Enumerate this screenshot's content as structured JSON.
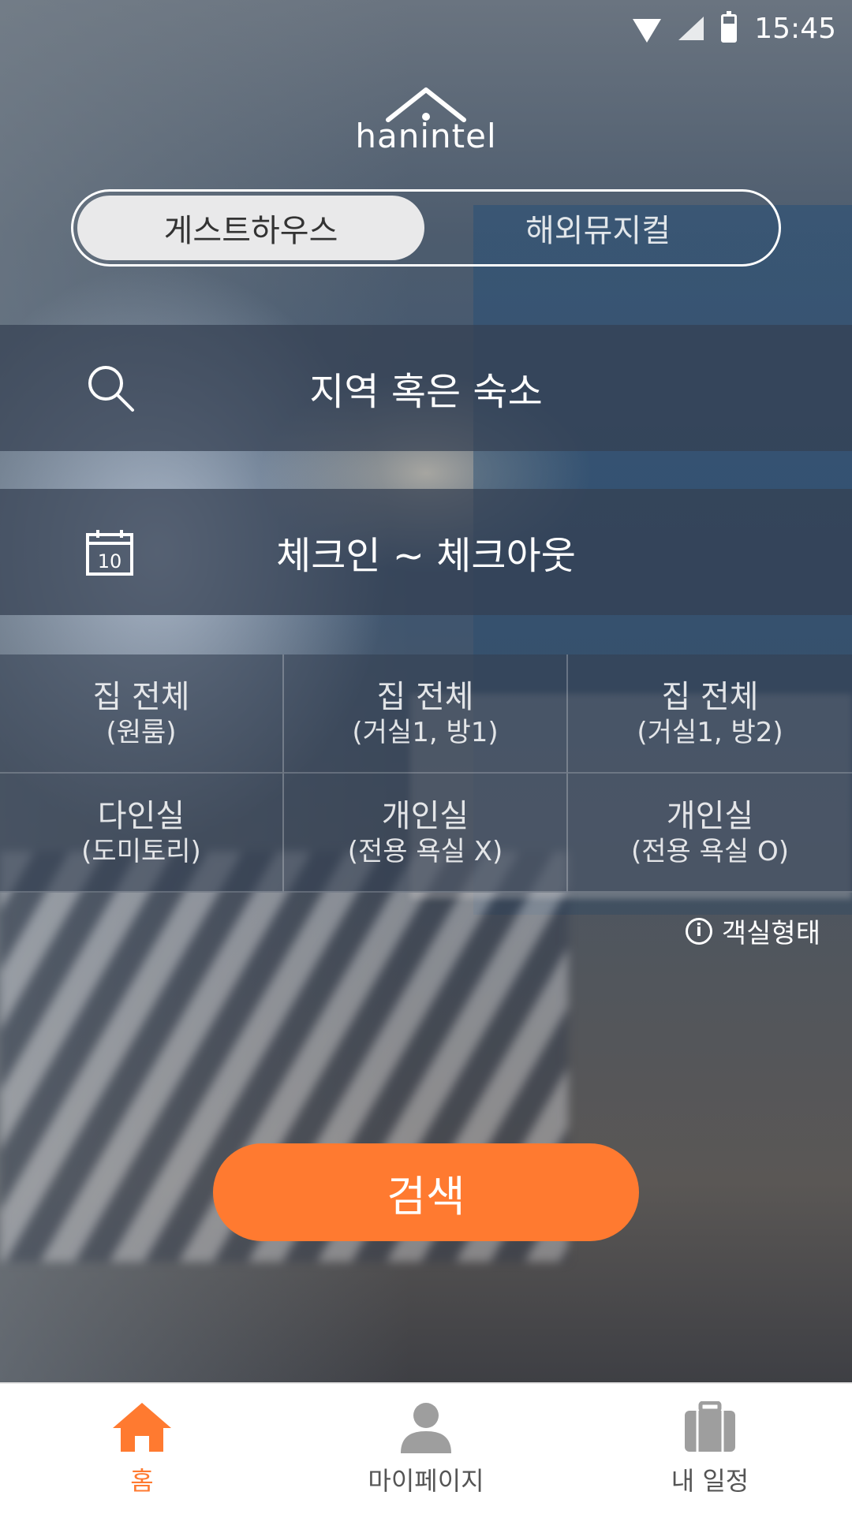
{
  "status_bar": {
    "time": "15:45"
  },
  "logo": {
    "text": "hanintel"
  },
  "toggle": {
    "options": [
      {
        "label": "게스트하우스",
        "active": true
      },
      {
        "label": "해외뮤지컬",
        "active": false
      }
    ]
  },
  "search_field": {
    "placeholder": "지역 혹은 숙소",
    "icon": "search-icon"
  },
  "date_field": {
    "placeholder": "체크인 ~ 체크아웃",
    "icon": "calendar-icon",
    "calendar_day": "10"
  },
  "room_types": [
    {
      "title": "집 전체",
      "sub": "(원룸)"
    },
    {
      "title": "집 전체",
      "sub": "(거실1, 방1)"
    },
    {
      "title": "집 전체",
      "sub": "(거실1, 방2)"
    },
    {
      "title": "다인실",
      "sub": "(도미토리)"
    },
    {
      "title": "개인실",
      "sub": "(전용 욕실 X)"
    },
    {
      "title": "개인실",
      "sub": "(전용 욕실 O)"
    }
  ],
  "info": {
    "label": "객실형태",
    "icon": "info-icon"
  },
  "search_button": {
    "label": "검색"
  },
  "bottom_nav": {
    "items": [
      {
        "label": "홈",
        "icon": "home-icon",
        "active": true
      },
      {
        "label": "마이페이지",
        "icon": "person-icon",
        "active": false
      },
      {
        "label": "내 일정",
        "icon": "suitcase-icon",
        "active": false
      }
    ]
  },
  "colors": {
    "accent": "#ff7a30",
    "nav_inactive": "#9e9e9e"
  }
}
